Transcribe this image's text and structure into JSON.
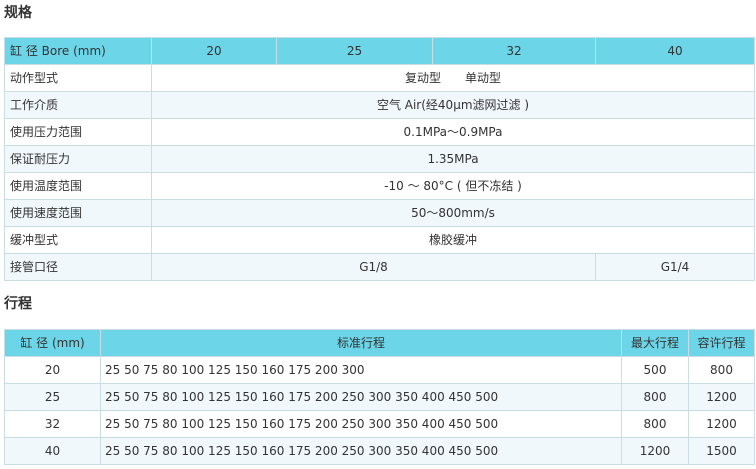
{
  "spec": {
    "title": "规格",
    "header": {
      "label": "缸 径 Bore (mm)",
      "bores": [
        "20",
        "25",
        "32",
        "40"
      ]
    },
    "rows": [
      {
        "label": "动作型式",
        "value": "复动型　　单动型"
      },
      {
        "label": "工作介质",
        "value": "空气 Air(经40μm滤网过滤 )"
      },
      {
        "label": "使用压力范围",
        "value": "0.1MPa～0.9MPa"
      },
      {
        "label": "保证耐压力",
        "value": "1.35MPa"
      },
      {
        "label": "使用温度范围",
        "value": "-10 ～ 80°C ( 但不冻结 )"
      },
      {
        "label": "使用速度范围",
        "value": "50～800mm/s"
      },
      {
        "label": "缓冲型式",
        "value": "橡胶缓冲"
      }
    ],
    "port": {
      "label": "接管口径",
      "small": "G1/8",
      "large": "G1/4"
    }
  },
  "stroke": {
    "title": "行程",
    "header": {
      "bore": "缸 径 (mm)",
      "standard": "标准行程",
      "max": "最大行程",
      "allow": "容许行程"
    },
    "rows": [
      {
        "bore": "20",
        "standard": "25 50 75 80 100 125 150 160 175 200 300",
        "max": "500",
        "allow": "800"
      },
      {
        "bore": "25",
        "standard": "25 50 75 80 100 125 150 160 175 200 250 300 350 400 450 500",
        "max": "800",
        "allow": "1200"
      },
      {
        "bore": "32",
        "standard": "25 50 75 80 100 125 150 160 175 200 250 300 350 400 450 500",
        "max": "800",
        "allow": "1200"
      },
      {
        "bore": "40",
        "standard": "25 50 75 80 100 125 150 160 175 200 250 300 350 400 450 500",
        "max": "1200",
        "allow": "1500"
      }
    ]
  }
}
